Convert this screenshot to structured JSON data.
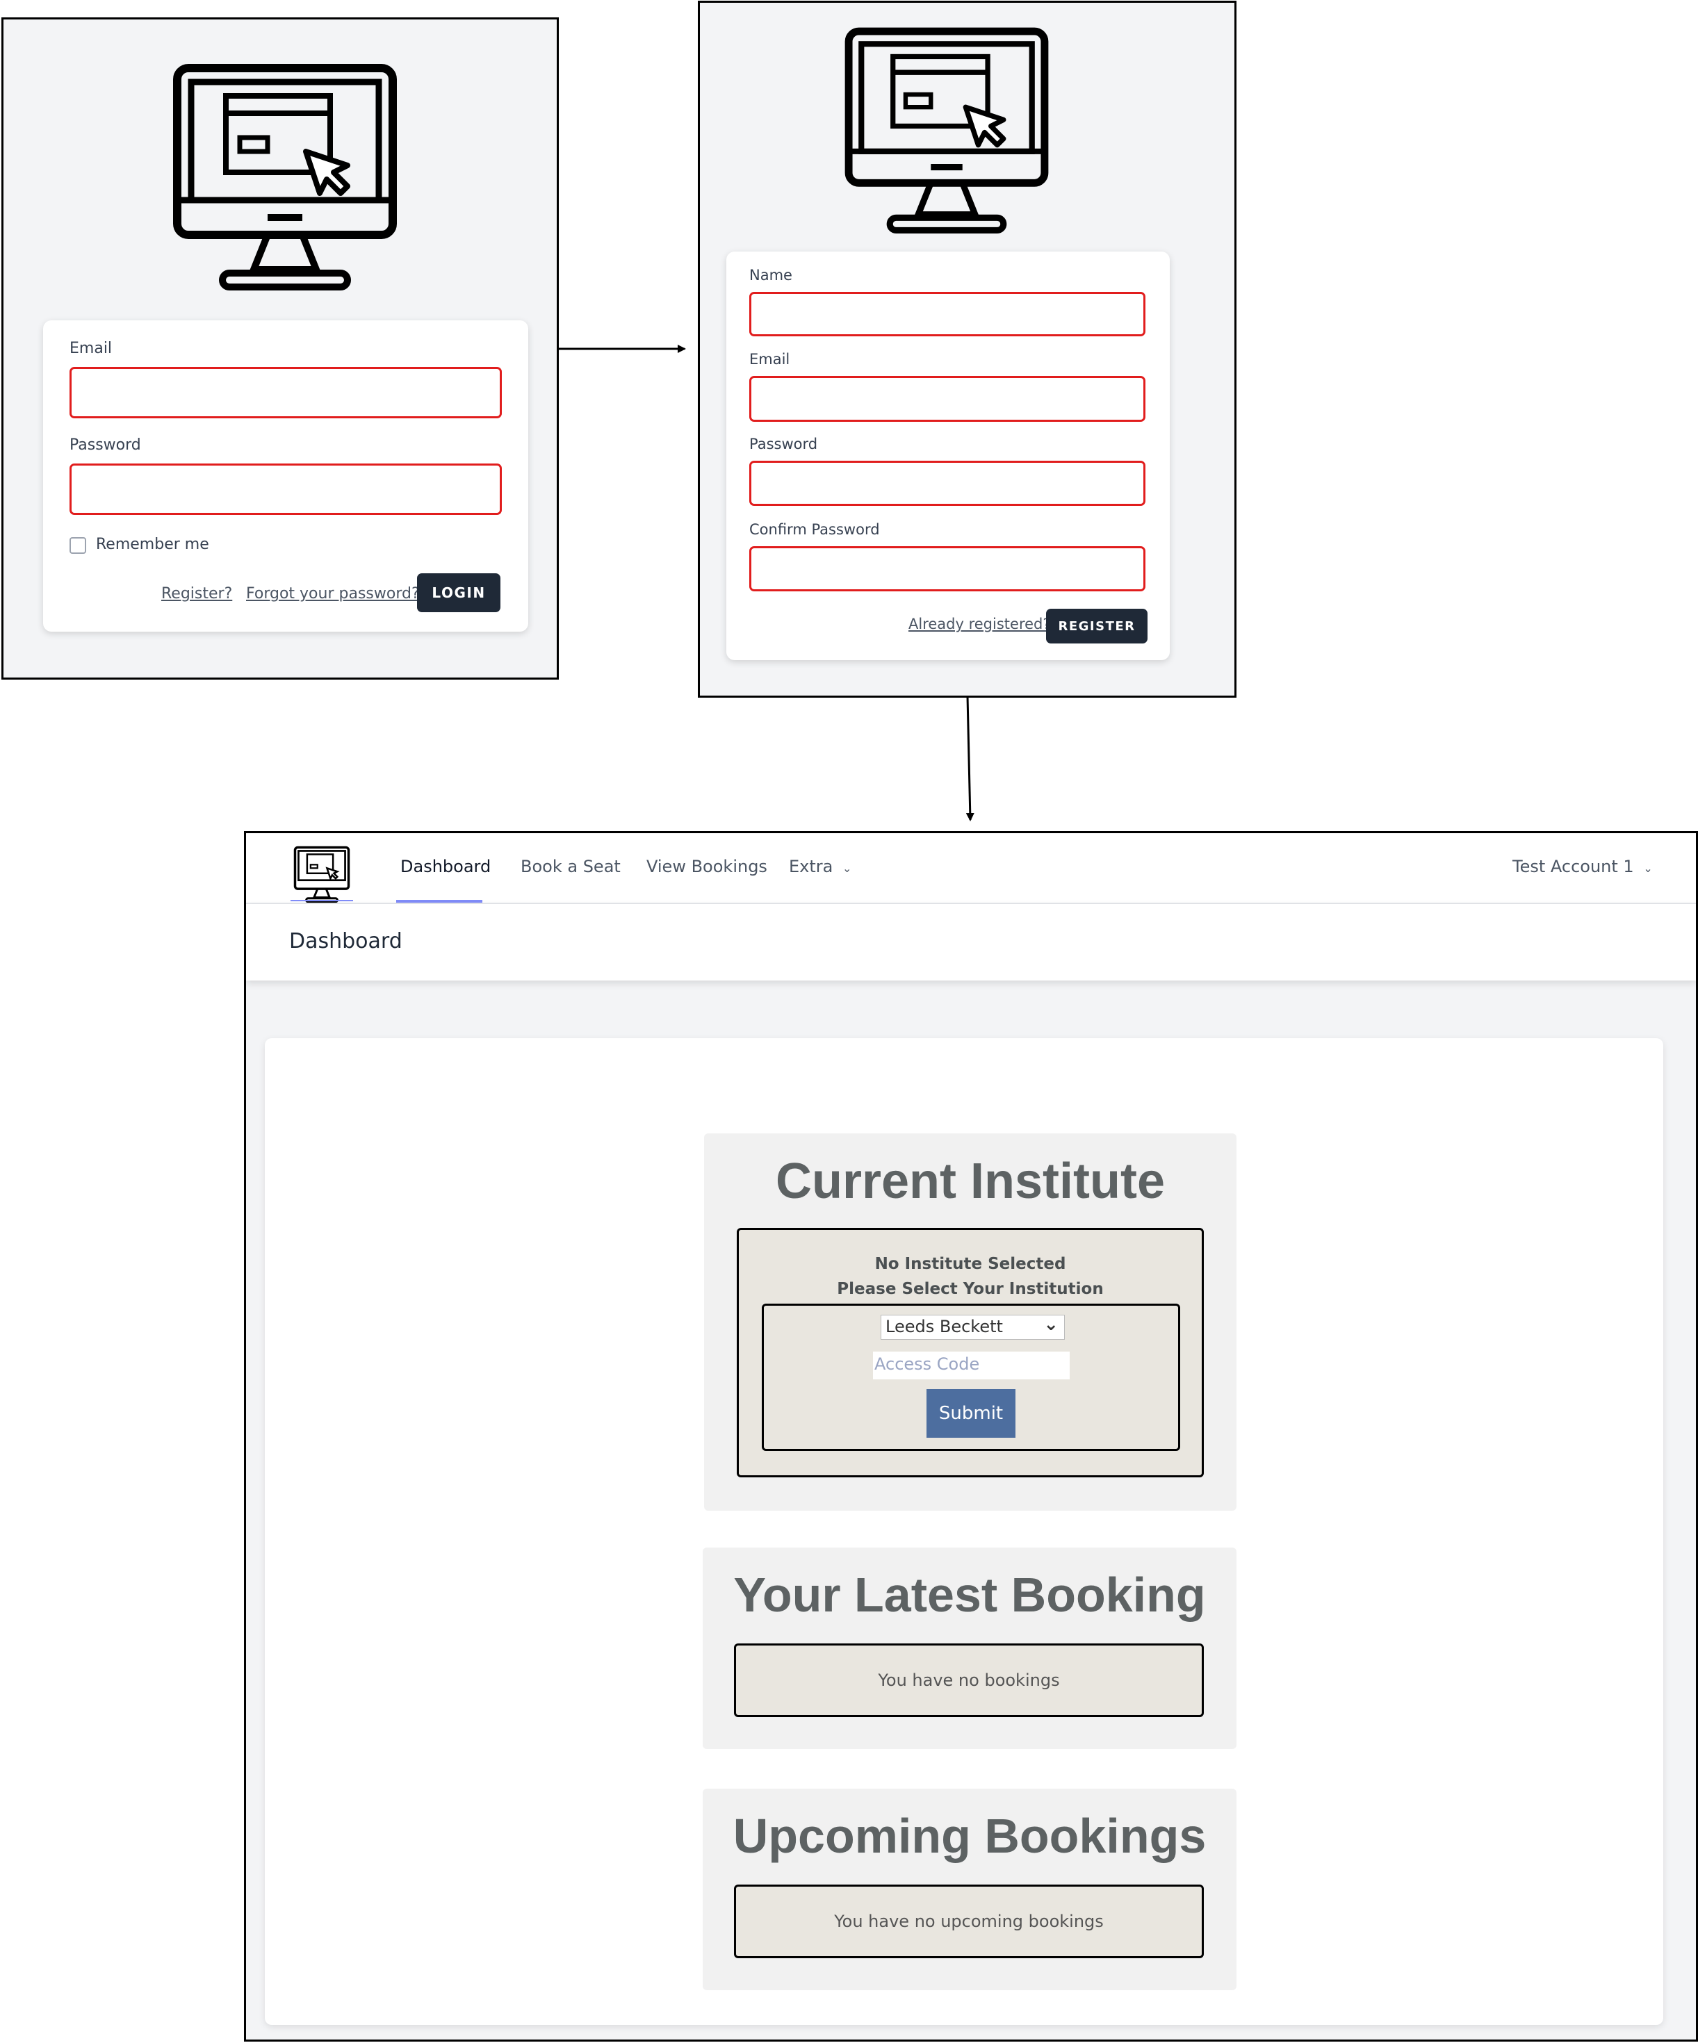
{
  "login": {
    "email_label": "Email",
    "password_label": "Password",
    "remember_label": "Remember me",
    "register_link": "Register?",
    "forgot_link": "Forgot your password?",
    "login_button": "LOGIN",
    "logo_icon": "computer-monitor-icon"
  },
  "register": {
    "name_label": "Name",
    "email_label": "Email",
    "password_label": "Password",
    "confirm_label": "Confirm Password",
    "already_link": "Already registered?",
    "register_button": "REGISTER",
    "logo_icon": "computer-monitor-icon"
  },
  "dashboard": {
    "nav": {
      "logo_icon": "computer-monitor-icon",
      "items": [
        "Dashboard",
        "Book a Seat",
        "View Bookings",
        "Extra"
      ],
      "active": "Dashboard",
      "account": "Test Account 1"
    },
    "header_title": "Dashboard",
    "current_institute": {
      "title": "Current Institute",
      "status": "No Institute Selected",
      "prompt": "Please Select Your Institution",
      "select_value": "Leeds Beckett",
      "access_placeholder": "Access Code",
      "submit_label": "Submit"
    },
    "latest_booking": {
      "title": "Your Latest Booking",
      "message": "You have no bookings"
    },
    "upcoming_bookings": {
      "title": "Upcoming Bookings",
      "message": "You have no upcoming bookings"
    }
  },
  "colors": {
    "error_border": "#e11d1d",
    "dark_button": "#1f2937",
    "submit_button": "#4d6e9f",
    "nav_underline": "#818cf8",
    "section_bg": "#f1f1f1",
    "message_bg": "#e9e6df"
  }
}
